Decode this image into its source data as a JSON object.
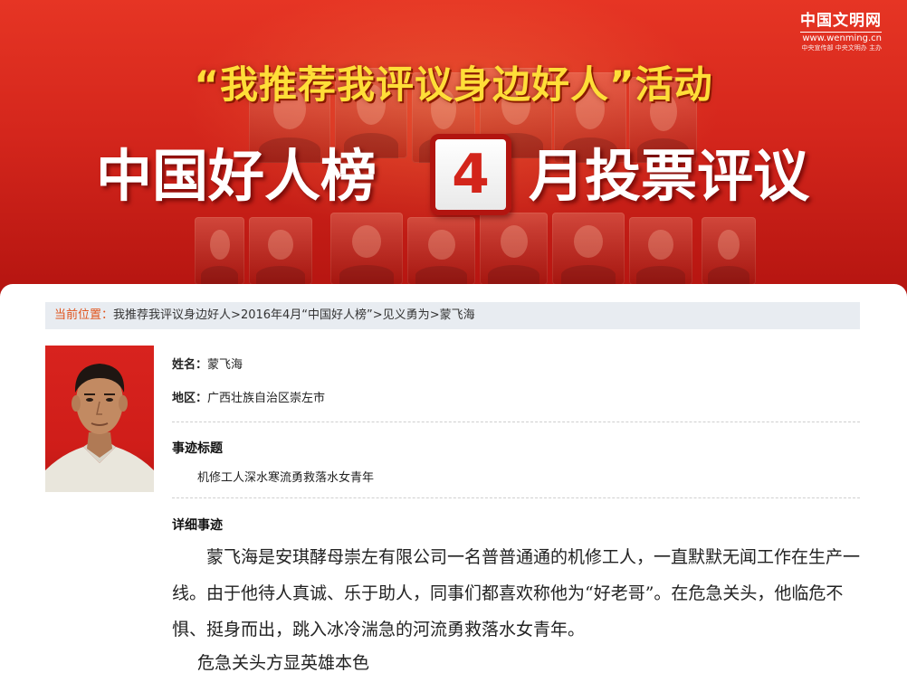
{
  "logo": {
    "name": "中国文明网",
    "url": "www.wenming.cn",
    "host": "中央宣传部  中央文明办  主办"
  },
  "banner": {
    "activity_title": "“我推荐我评议身边好人”活动",
    "headline_left": "中国好人榜",
    "month": "4",
    "headline_right": "月投票评议"
  },
  "breadcrumb": {
    "lead": "当前位置：",
    "items": [
      "我推荐我评议身边好人",
      "2016年4月“中国好人榜”",
      "见义勇为",
      "蒙飞海"
    ],
    "separator": ">"
  },
  "profile": {
    "name_label": "姓名：",
    "name": "蒙飞海",
    "region_label": "地区：",
    "region": "广西壮族自治区崇左市"
  },
  "story": {
    "title_heading": "事迹标题",
    "title": "机修工人深水寒流勇救落水女青年",
    "detail_heading": "详细事迹",
    "paragraph": "蒙飞海是安琪酵母崇左有限公司一名普普通通的机修工人，一直默默无闻工作在生产一线。由于他待人真诚、乐于助人，同事们都喜欢称他为“好老哥”。在危急关头，他临危不惧、挺身而出，跳入冰冷湍急的河流勇救落水女青年。",
    "subheading": "危急关头方显英雄本色"
  }
}
